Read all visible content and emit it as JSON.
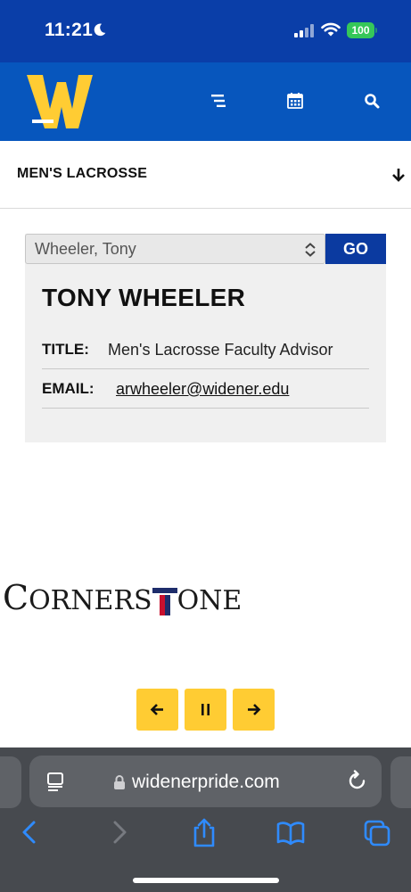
{
  "status_bar": {
    "time": "11:21",
    "battery": "100"
  },
  "header": {
    "logo_letter": "W",
    "icons": [
      "menu-icon",
      "calendar-icon",
      "search-icon"
    ],
    "brand_color": "#0756bd",
    "accent_color": "#ffcc33"
  },
  "sport_selector": {
    "label": "MEN'S LACROSSE"
  },
  "staff": {
    "select_value": "Wheeler, Tony",
    "go_label": "GO",
    "name": "TONY WHEELER",
    "title_label": "TITLE:",
    "title_value": "Men's Lacrosse Faculty Advisor",
    "email_label": "EMAIL:",
    "email_value": "arwheeler@widener.edu"
  },
  "sponsor": {
    "name": "CornersTone",
    "part1_big": "C",
    "part1_small": "ORNERS",
    "part2_small": "ONE"
  },
  "carousel": {
    "controls": [
      "prev-arrow-icon",
      "pause-icon",
      "next-arrow-icon"
    ]
  },
  "browser": {
    "url": "widenerpride.com"
  }
}
